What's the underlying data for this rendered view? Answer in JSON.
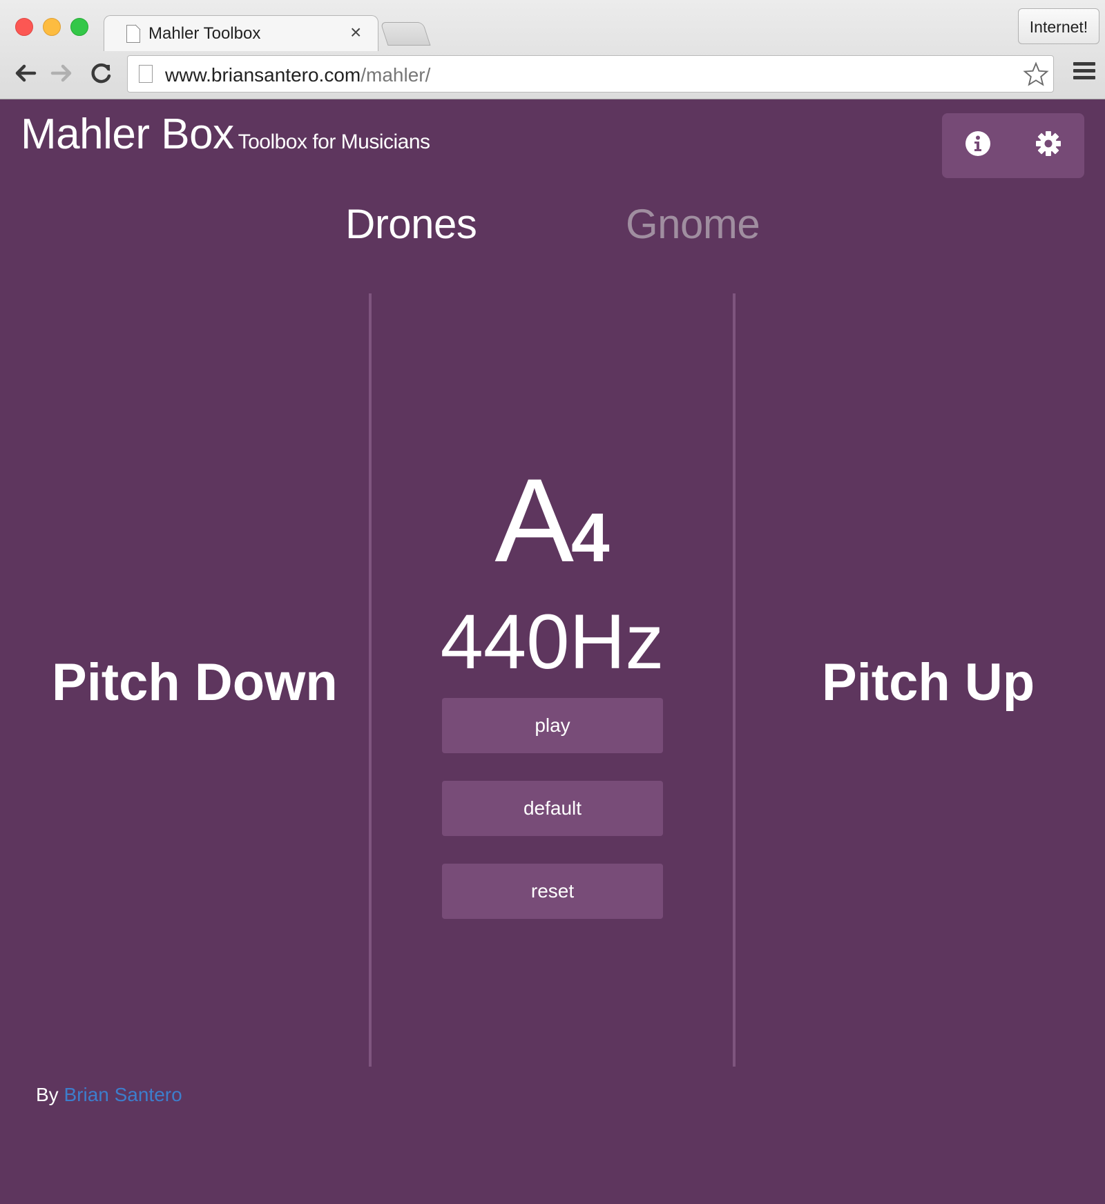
{
  "browser": {
    "tab_title": "Mahler Toolbox",
    "tab_close": "×",
    "profile_label": "Internet!",
    "url_domain": "www.briansantero.com",
    "url_path": "/mahler/"
  },
  "header": {
    "title": "Mahler Box",
    "subtitle": "Toolbox for Musicians",
    "info_icon": "info-icon",
    "settings_icon": "gear-icon"
  },
  "mode_tabs": [
    {
      "label": "Drones",
      "active": true
    },
    {
      "label": "Gnome",
      "active": false
    }
  ],
  "drone": {
    "pitch_down_label": "Pitch Down",
    "pitch_up_label": "Pitch Up",
    "note_letter": "A",
    "note_octave": "4",
    "frequency": "440Hz",
    "buttons": {
      "play": "play",
      "default": "default",
      "reset": "reset"
    }
  },
  "footer": {
    "by": "By",
    "author": "Brian Santero"
  },
  "colors": {
    "background": "#5e365e",
    "panel": "#784c78",
    "link": "#3d7ecc",
    "inactive_tab": "#a08ea0"
  }
}
